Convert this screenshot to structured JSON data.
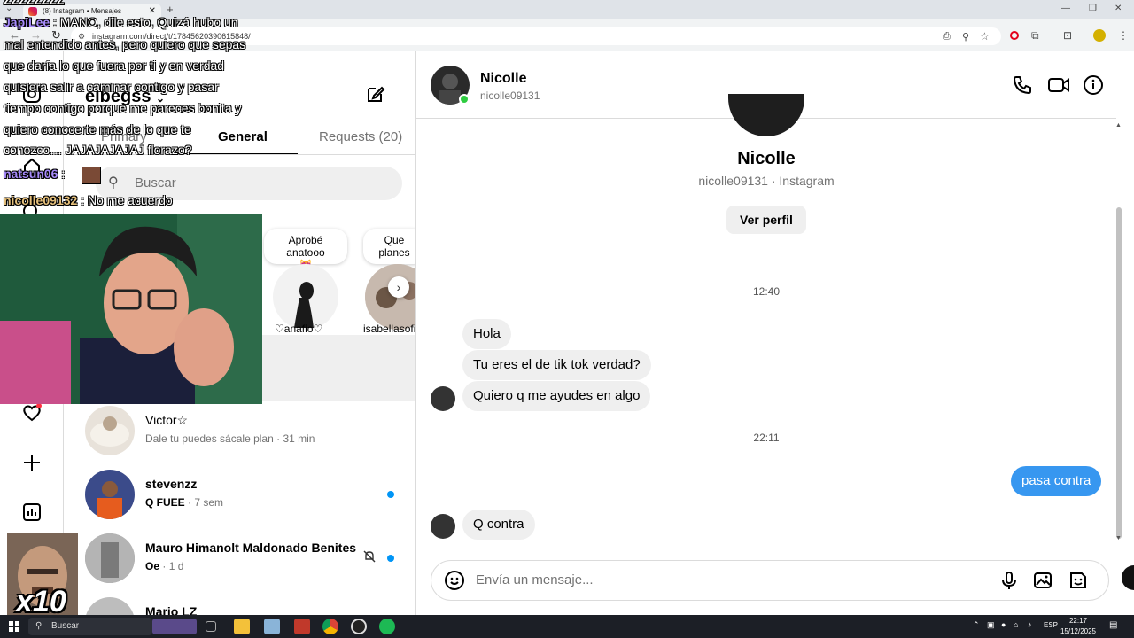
{
  "browser": {
    "tab_title": "(8) Instagram • Mensajes",
    "url": "instagram.com/direct/t/17845620390615848/"
  },
  "inbox": {
    "username": "elbegss",
    "tabs": [
      "Primary",
      "General",
      "Requests (20)"
    ],
    "search_placeholder": "Buscar",
    "notes": [
      {
        "text": "Aprobé anatooo",
        "emoji": "😻",
        "name": "anafio"
      },
      {
        "text": "Que planes",
        "name": "isabellasofia"
      }
    ],
    "conversations": [
      {
        "name": "Victor☆",
        "preview": "Dale tu puedes sácale plan",
        "time": "31 min",
        "unread": false
      },
      {
        "name": "stevenzz",
        "preview": "Q FUEE",
        "time": "7 sem",
        "unread": true
      },
      {
        "name": "Mauro Himanolt Maldonado Benites",
        "preview": "Oe",
        "time": "1 d",
        "unread": true,
        "muted": true
      },
      {
        "name": "Mario LZ",
        "preview": "",
        "time": ""
      }
    ]
  },
  "conversation": {
    "name": "Nicolle",
    "handle": "nicolle09131",
    "profile_sub": "nicolle09131 · Instagram",
    "view_profile": "Ver perfil",
    "times": [
      "12:40",
      "22:11"
    ],
    "messages": [
      {
        "text": "Hola",
        "from": "them"
      },
      {
        "text": "Tu eres el de tik tok verdad?",
        "from": "them"
      },
      {
        "text": "Quiero q me ayudes en algo",
        "from": "them"
      },
      {
        "text": "pasa contra",
        "from": "me"
      },
      {
        "text": "Q contra",
        "from": "them"
      }
    ],
    "composer_placeholder": "Envía un mensaje..."
  },
  "stream_chat": [
    {
      "user": "ZZZZZZZZ",
      "text": ""
    },
    {
      "user": "JapiLee",
      "text": ": MANO, dile esto, Quizá hubo un"
    },
    {
      "user": "",
      "text": "mal entendido antes, pero quiero que sepas"
    },
    {
      "user": "",
      "text": "que daría lo que fuera por ti y en verdad"
    },
    {
      "user": "",
      "text": "quisiera salir a caminar contigo y pasar"
    },
    {
      "user": "",
      "text": "tiempo contigo porque me pareces bonita y"
    },
    {
      "user": "",
      "text": "quiero conocerte más de lo que te"
    },
    {
      "user": "",
      "text": "conozco… JAJAJAJAJAJ florazo?"
    },
    {
      "user": "natsun06",
      "text": ":"
    },
    {
      "user": "nicolle09132",
      "text": ": No me acuerdo"
    }
  ],
  "meme_counter": "x10",
  "taskbar": {
    "search": "Buscar",
    "lang": "ESP",
    "time": "22:17",
    "date": "15/12/2025"
  },
  "colors": {
    "accent_blue": "#0095f6",
    "bubble_out": "#3797f0",
    "online": "#2ecc40",
    "chat_user_purple": "#a78bfa",
    "chat_user_gold": "#e6c07b"
  }
}
